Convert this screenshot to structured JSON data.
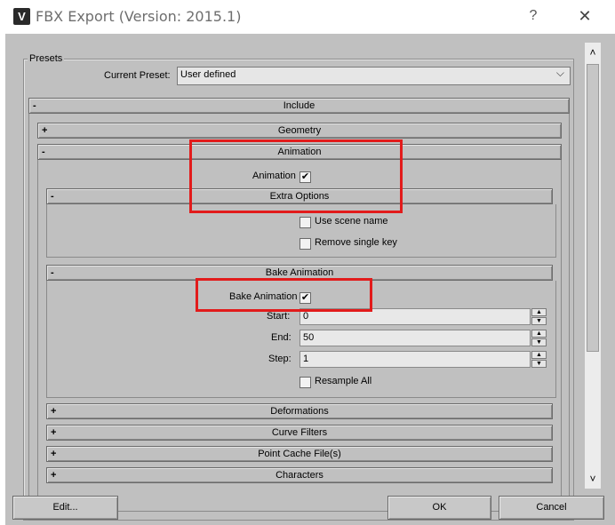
{
  "window": {
    "title": "FBX Export (Version: 2015.1)",
    "help_label": "?",
    "close_label": "✕"
  },
  "presets": {
    "group_label": "Presets",
    "current_preset_label": "Current Preset:",
    "current_preset_value": "User defined"
  },
  "include": {
    "sign": "-",
    "label": "Include"
  },
  "geometry": {
    "sign": "+",
    "label": "Geometry"
  },
  "animation": {
    "sign": "-",
    "label": "Animation",
    "checkbox_label": "Animation",
    "checked_mark": "✔"
  },
  "extra_options": {
    "sign": "-",
    "label": "Extra Options",
    "use_scene_name": "Use scene name",
    "remove_single_key": "Remove single key"
  },
  "bake_animation": {
    "sign": "-",
    "label": "Bake Animation",
    "checkbox_label": "Bake Animation",
    "checked_mark": "✔",
    "start_label": "Start:",
    "start_value": "0",
    "end_label": "End:",
    "end_value": "50",
    "step_label": "Step:",
    "step_value": "1",
    "resample_all": "Resample All"
  },
  "collapsed": [
    {
      "sign": "+",
      "label": "Deformations"
    },
    {
      "sign": "+",
      "label": "Curve Filters"
    },
    {
      "sign": "+",
      "label": "Point Cache File(s)"
    },
    {
      "sign": "+",
      "label": "Characters"
    }
  ],
  "buttons": {
    "edit": "Edit...",
    "ok": "OK",
    "cancel": "Cancel"
  },
  "icons": {
    "app": "3ds-max-icon",
    "spin_up": "▲",
    "spin_down": "▼",
    "scroll_up": "˄",
    "scroll_down": "˅",
    "chevron": "⌵"
  },
  "colors": {
    "dialog_bg": "#c0c0c0",
    "highlight": "#e21b1b"
  }
}
